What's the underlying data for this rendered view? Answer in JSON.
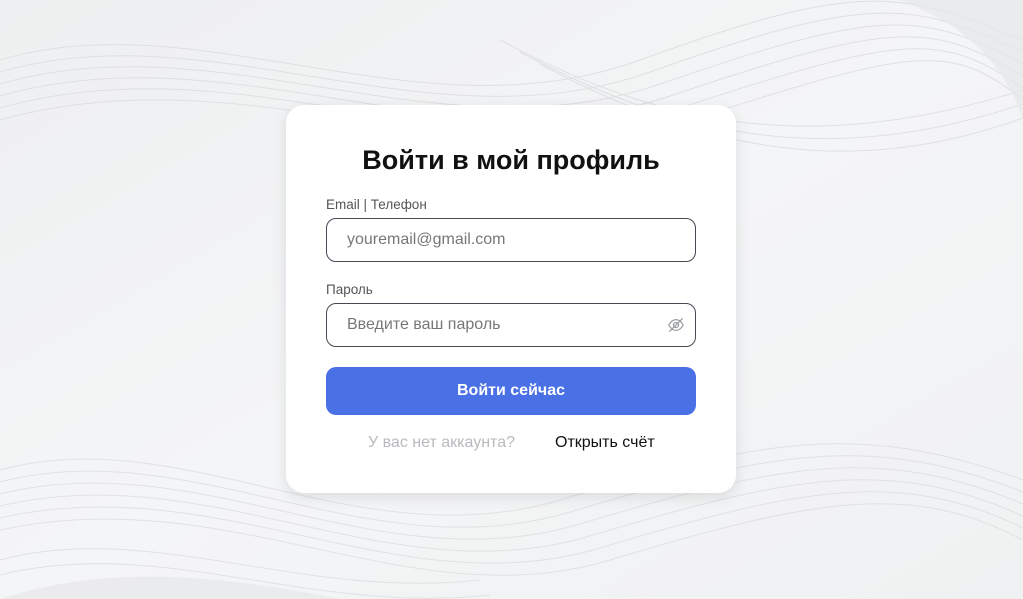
{
  "form": {
    "title": "Войти в мой профиль",
    "email_label": "Email | Телефон",
    "email_placeholder": "youremail@gmail.com",
    "password_label": "Пароль",
    "password_placeholder": "Введите ваш пароль",
    "submit_label": "Войти сейчас",
    "no_account_text": "У вас нет аккаунта?",
    "open_account_label": "Открыть счёт"
  },
  "icons": {
    "password_toggle": "eye-off-icon"
  },
  "colors": {
    "primary": "#4a70e6",
    "background": "#f1f2f3",
    "muted_text": "#b7b9bd"
  }
}
